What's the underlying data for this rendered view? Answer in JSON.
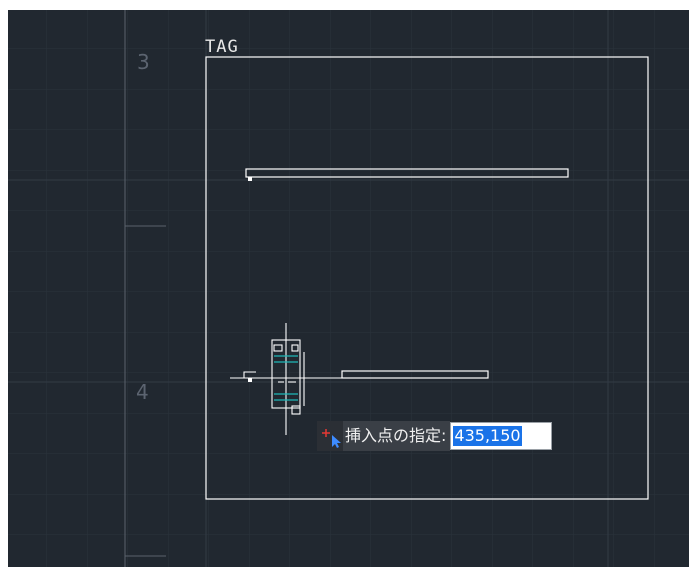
{
  "drawing": {
    "tag_text": "TAG",
    "row_numbers": [
      "3",
      "4"
    ]
  },
  "command_prompt": {
    "label": "挿入点の指定:",
    "value": "435,150"
  },
  "colors": {
    "background": "#212830",
    "grid": "#2c343d",
    "lines": "#ffffff",
    "accent_cyan": "#00b3b3",
    "selection": "#1a73e8"
  },
  "icons": {
    "prompt_icon": "insert-point-cursor-icon"
  }
}
